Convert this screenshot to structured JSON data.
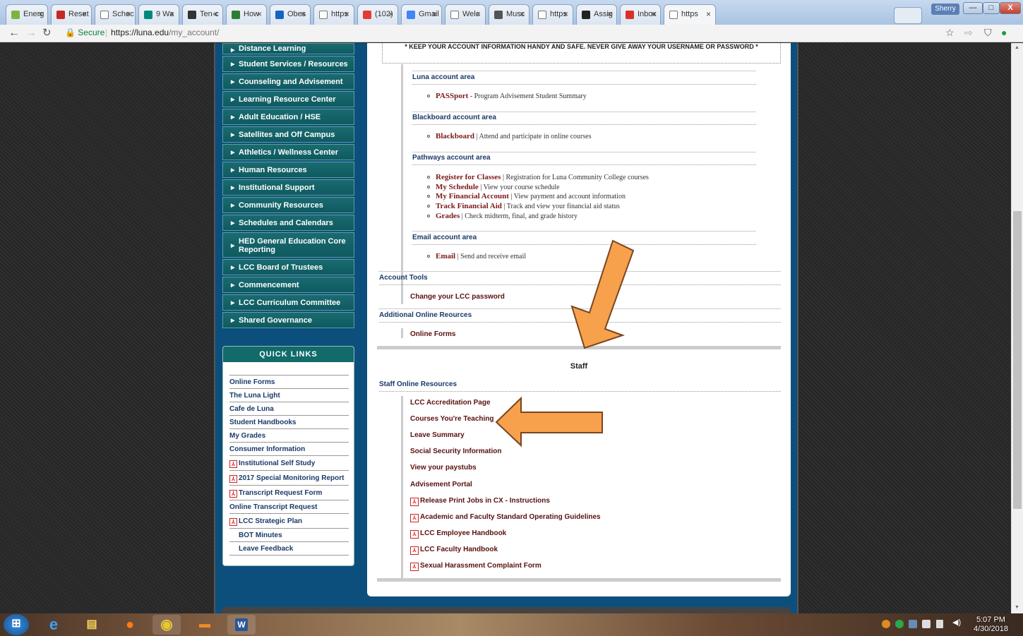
{
  "browser": {
    "tabs": [
      {
        "label": "Energ",
        "icon": "leaf-icon",
        "color": "#7cb342"
      },
      {
        "label": "Reset",
        "icon": "mascot-icon",
        "color": "#c62828"
      },
      {
        "label": "Schoo",
        "icon": "page-icon",
        "color": "#ffffff"
      },
      {
        "label": "9 Wa",
        "icon": "app-icon",
        "color": "#00897b"
      },
      {
        "label": "Ten-c",
        "icon": "tp-icon",
        "color": "#333333"
      },
      {
        "label": "How",
        "icon": "app-icon",
        "color": "#2e7d32"
      },
      {
        "label": "Obes",
        "icon": "oac-icon",
        "color": "#1565c0"
      },
      {
        "label": "https",
        "icon": "page-icon",
        "color": "#ffffff"
      },
      {
        "label": "(102)",
        "icon": "youtube-icon",
        "color": "#e53935"
      },
      {
        "label": "Gmail",
        "icon": "google-icon",
        "color": "#4285f4"
      },
      {
        "label": "Welc",
        "icon": "page-icon",
        "color": "#ffffff"
      },
      {
        "label": "Musc",
        "icon": "chart-icon",
        "color": "#555555"
      },
      {
        "label": "https",
        "icon": "page-icon",
        "color": "#ffffff"
      },
      {
        "label": "Assig",
        "icon": "blackboard-icon",
        "color": "#222222"
      },
      {
        "label": "Inbox",
        "icon": "gmail-icon",
        "color": "#d93025"
      },
      {
        "label": "https",
        "icon": "page-icon",
        "color": "#ffffff"
      }
    ],
    "profile_label": "Sherry",
    "window_controls": {
      "minimize": "—",
      "maximize": "□",
      "close": "X"
    },
    "secure_label": "Secure",
    "url_host": "https://luna.edu",
    "url_path": "/my_account/"
  },
  "left_nav": [
    "Distance Learning",
    "Student Services / Resources",
    "Counseling and Advisement",
    "Learning Resource Center",
    "Adult Education / HSE",
    "Satellites and Off Campus",
    "Athletics / Wellness Center",
    "Human Resources",
    "Institutional Support",
    "Community Resources",
    "Schedules and Calendars",
    "HED General Education Core Reporting",
    "LCC Board of Trustees",
    "Commencement",
    "LCC Curriculum Committee",
    "Shared Governance"
  ],
  "quick_links": {
    "title": "QUICK LINKS",
    "items": [
      {
        "label": "Online Forms",
        "pdf": false
      },
      {
        "label": "The Luna Light",
        "pdf": false
      },
      {
        "label": "Cafe de Luna",
        "pdf": false
      },
      {
        "label": "Student Handbooks",
        "pdf": false
      },
      {
        "label": "My Grades",
        "pdf": false
      },
      {
        "label": "Consumer Information",
        "pdf": false
      },
      {
        "label": "Institutional Self Study",
        "pdf": true
      },
      {
        "label": "2017 Special Monitoring Report",
        "pdf": true
      },
      {
        "label": "Transcript Request Form",
        "pdf": true
      },
      {
        "label": "Online Transcript Request",
        "pdf": false
      },
      {
        "label": "LCC Strategic Plan",
        "pdf": true
      },
      {
        "label": "BOT Minutes",
        "pdf": false,
        "indent": true
      },
      {
        "label": "Leave Feedback",
        "pdf": false,
        "indent": true
      }
    ]
  },
  "content": {
    "warning": "* KEEP YOUR ACCOUNT INFORMATION HANDY AND SAFE. NEVER GIVE AWAY YOUR USERNAME OR PASSWORD *",
    "luna": {
      "heading": "Luna account area",
      "items": [
        {
          "link": "PASSport",
          "desc": " - Program Advisement Student Summary"
        }
      ]
    },
    "blackboard": {
      "heading": "Blackboard account area",
      "items": [
        {
          "link": "Blackboard",
          "desc": " | Attend and participate in online courses"
        }
      ]
    },
    "pathways": {
      "heading": "Pathways account area",
      "items": [
        {
          "link": "Register for Classes",
          "desc": " | Registration for Luna Community College courses"
        },
        {
          "link": "My Schedule",
          "desc": " | View your course schedule"
        },
        {
          "link": "My Financial Account",
          "desc": " | View payment and account information"
        },
        {
          "link": "Track Financial Aid",
          "desc": " | Track and view your financial aid status"
        },
        {
          "link": "Grades",
          "desc": " | Check midterm, final, and grade history"
        }
      ]
    },
    "email": {
      "heading": "Email account area",
      "items": [
        {
          "link": "Email",
          "desc": " | Send and receive email"
        }
      ]
    },
    "account_tools": {
      "heading": "Account Tools",
      "link": "Change your LCC password"
    },
    "additional": {
      "heading": "Additional Online Reources",
      "link": "Online Forms"
    },
    "staff_title": "Staff",
    "staff_resources": {
      "heading": "Staff Online Resources",
      "items": [
        {
          "label": "LCC Accreditation Page",
          "pdf": false
        },
        {
          "label": "Courses You're Teaching",
          "pdf": false
        },
        {
          "label": "Leave Summary",
          "pdf": false
        },
        {
          "label": "Social Security Information",
          "pdf": false
        },
        {
          "label": "View your paystubs",
          "pdf": false
        },
        {
          "label": "Advisement Portal",
          "pdf": false
        },
        {
          "label": "Release Print Jobs in CX - Instructions",
          "pdf": true
        },
        {
          "label": "Academic and Faculty Standard Operating Guidelines",
          "pdf": true
        },
        {
          "label": "LCC Employee Handbook",
          "pdf": true
        },
        {
          "label": "LCC Faculty Handbook",
          "pdf": true
        },
        {
          "label": "Sexual Harassment Complaint Form",
          "pdf": true
        }
      ]
    }
  },
  "annotation_color": "#f7a14d",
  "taskbar": {
    "apps": [
      "start-button",
      "internet-explorer-icon",
      "file-explorer-icon",
      "firefox-icon",
      "chrome-icon",
      "app-icon",
      "word-icon"
    ],
    "time": "5:07 PM",
    "date": "4/30/2018"
  }
}
